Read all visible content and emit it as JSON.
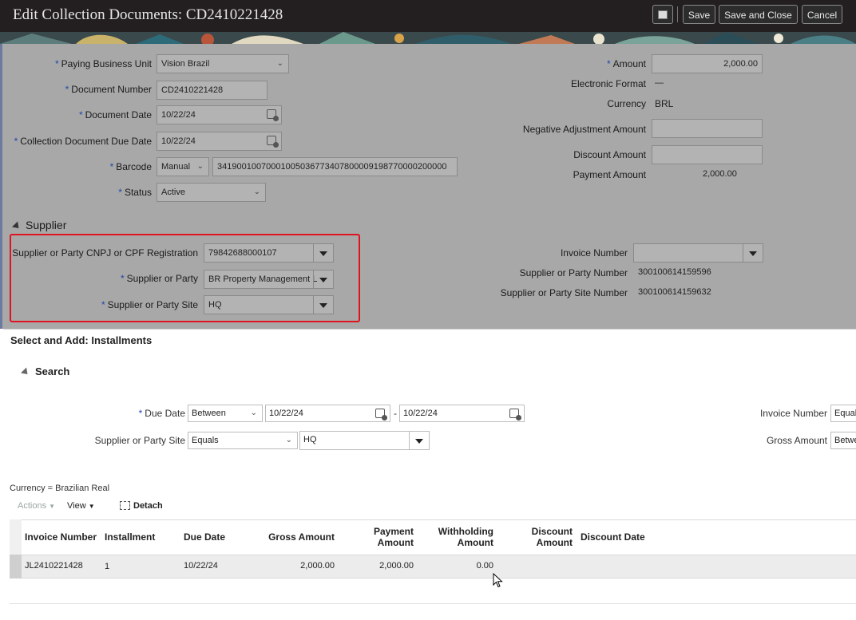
{
  "header": {
    "title": "Edit Collection Documents: CD2410221428",
    "save_label": "Save",
    "save_close_label": "Save and Close",
    "cancel_label": "Cancel"
  },
  "form": {
    "paying_bu": {
      "label": "Paying Business Unit",
      "value": "Vision Brazil"
    },
    "document_number": {
      "label": "Document Number",
      "value": "CD2410221428"
    },
    "document_date": {
      "label": "Document Date",
      "value": "10/22/24"
    },
    "due_date": {
      "label": "Collection Document Due Date",
      "value": "10/22/24"
    },
    "barcode": {
      "label": "Barcode",
      "type": "Manual",
      "value": "34190010070001005036773407800009198770000200000"
    },
    "status": {
      "label": "Status",
      "value": "Active"
    },
    "amount": {
      "label": "Amount",
      "value": "2,000.00"
    },
    "electronic_format": {
      "label": "Electronic Format",
      "value": "—"
    },
    "currency": {
      "label": "Currency",
      "value": "BRL"
    },
    "negative_adjustment": {
      "label": "Negative Adjustment Amount",
      "value": ""
    },
    "discount_amount": {
      "label": "Discount Amount",
      "value": ""
    },
    "payment_amount": {
      "label": "Payment Amount",
      "value": "2,000.00"
    }
  },
  "supplier": {
    "section_title": "Supplier",
    "cnpj": {
      "label": "Supplier or Party CNPJ or CPF Registration",
      "value": "79842688000107"
    },
    "party": {
      "label": "Supplier or Party",
      "value": "BR Property Management L"
    },
    "site": {
      "label": "Supplier or Party Site",
      "value": "HQ"
    },
    "invoice_number": {
      "label": "Invoice Number",
      "value": ""
    },
    "party_number": {
      "label": "Supplier or Party Number",
      "value": "300100614159596"
    },
    "site_number": {
      "label": "Supplier or Party Site Number",
      "value": "300100614159632"
    }
  },
  "dialog": {
    "title": "Select and Add: Installments",
    "search_title": "Search",
    "due_date": {
      "label": "Due Date",
      "operator": "Between",
      "from": "10/22/24",
      "sep": "-",
      "to": "10/22/24"
    },
    "site": {
      "label": "Supplier or Party Site",
      "operator": "Equals",
      "value": "HQ"
    },
    "invoice_number": {
      "label": "Invoice Number",
      "operator": "Equals"
    },
    "gross_amount": {
      "label": "Gross Amount",
      "operator": "Betwe"
    },
    "currency_note": "Currency = Brazilian Real",
    "toolbar": {
      "actions": "Actions",
      "view": "View",
      "detach": "Detach"
    },
    "table": {
      "columns": [
        {
          "l1": "",
          "l2": "Invoice Number"
        },
        {
          "l1": "",
          "l2": "Installment"
        },
        {
          "l1": "",
          "l2": "Due Date"
        },
        {
          "l1": "",
          "l2": "Gross Amount"
        },
        {
          "l1": "Payment",
          "l2": "Amount"
        },
        {
          "l1": "Withholding",
          "l2": "Amount"
        },
        {
          "l1": "Discount",
          "l2": "Amount"
        },
        {
          "l1": "",
          "l2": "Discount Date"
        }
      ],
      "rows": [
        {
          "invoice_number": "JL2410221428",
          "installment": "1",
          "due_date": "10/22/24",
          "gross_amount": "2,000.00",
          "payment_amount": "2,000.00",
          "withholding_amount": "0.00",
          "discount_amount": "",
          "discount_date": ""
        }
      ]
    }
  },
  "colors": {
    "header_bg": "#231f20",
    "required": "#1f4aa8",
    "highlight_box": "#e0141e"
  }
}
